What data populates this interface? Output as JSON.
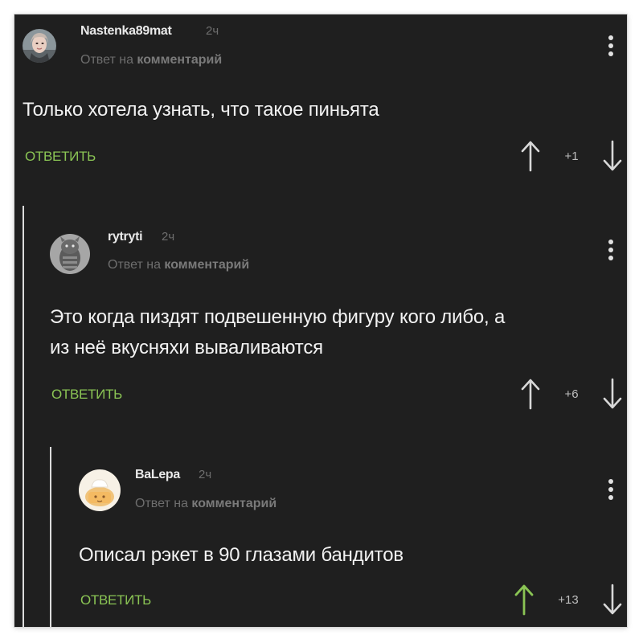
{
  "colors": {
    "background": "#1f1f1f",
    "accent": "#8ac454",
    "text": "#f2f2f2",
    "muted": "#6e6e6e"
  },
  "icons": {
    "kebab": "kebab-menu-icon",
    "upvote": "arrow-up-icon",
    "downvote": "arrow-down-icon"
  },
  "comments": [
    {
      "username": "Nastenka89mat",
      "time": "2ч",
      "reply_prefix": "Ответ на",
      "reply_target": "комментарий",
      "text_lines": [
        "Только хотела узнать, что такое пиньята"
      ],
      "reply_label": "ОТВЕТИТЬ",
      "score": "+1",
      "upvoted": false
    },
    {
      "username": "rytryti",
      "time": "2ч",
      "reply_prefix": "Ответ на",
      "reply_target": "комментарий",
      "text_lines": [
        "Это когда пиздят подвешенную фигуру кого либо, а",
        "из неё вкусняхи вываливаются"
      ],
      "reply_label": "ОТВЕТИТЬ",
      "score": "+6",
      "upvoted": false
    },
    {
      "username": "BaLepa",
      "time": "2ч",
      "reply_prefix": "Ответ на",
      "reply_target": "комментарий",
      "text_lines": [
        "Описал рэкет в 90 глазами бандитов"
      ],
      "reply_label": "ОТВЕТИТЬ",
      "score": "+13",
      "upvoted": true
    }
  ]
}
